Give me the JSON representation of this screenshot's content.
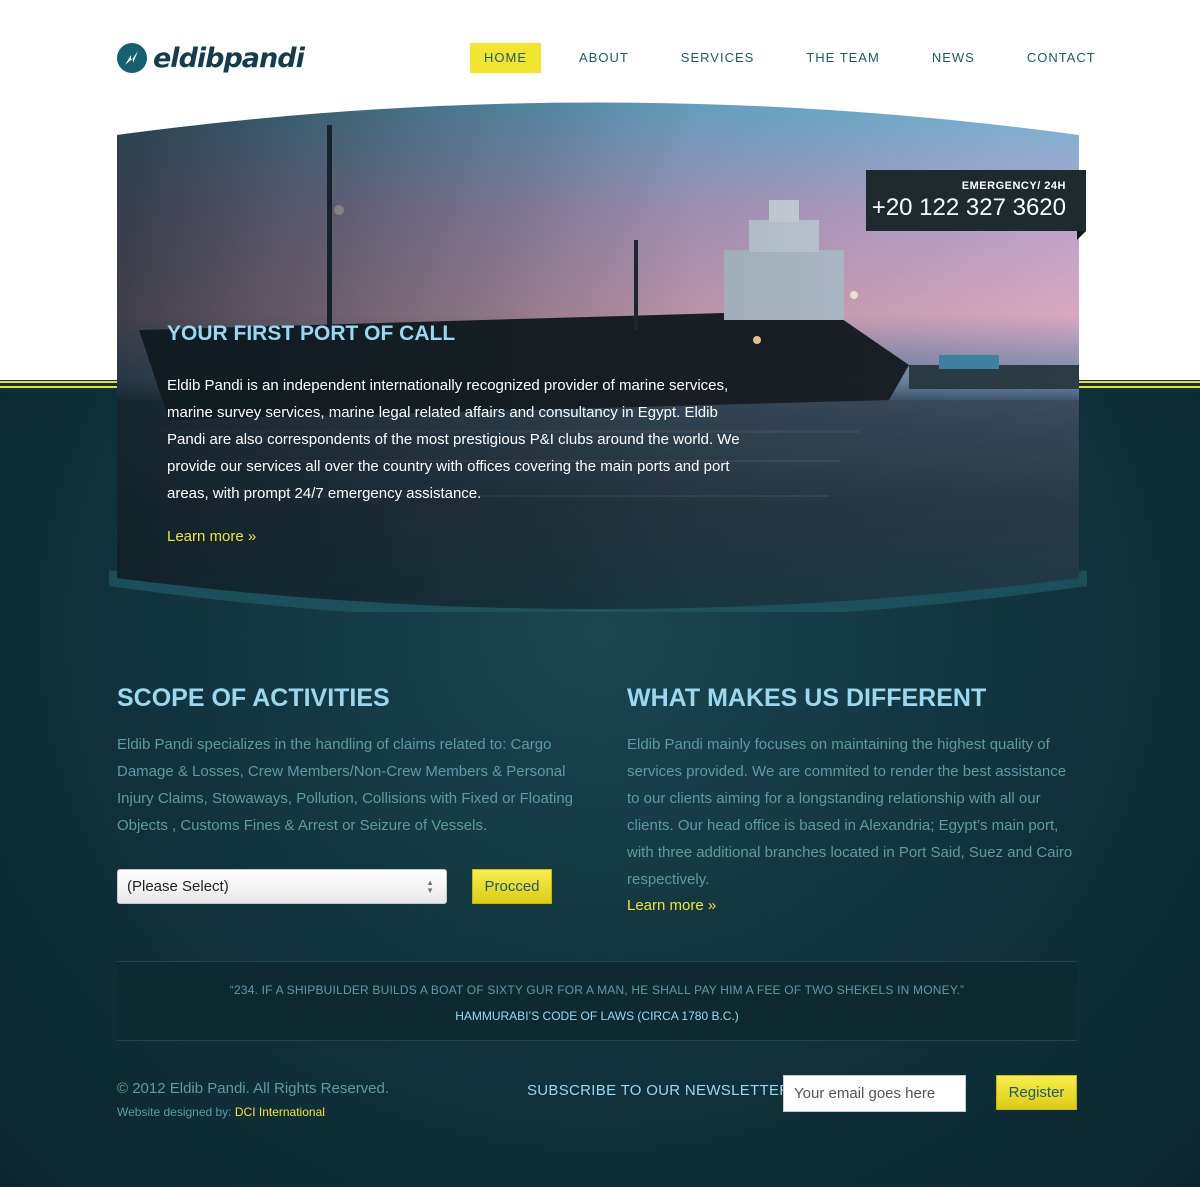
{
  "header": {
    "logo_text": "eldibpandi",
    "nav": [
      {
        "label": "HOME",
        "active": true
      },
      {
        "label": "ABOUT",
        "active": false
      },
      {
        "label": "SERVICES",
        "active": false
      },
      {
        "label": "THE TEAM",
        "active": false
      },
      {
        "label": "NEWS",
        "active": false
      },
      {
        "label": "CONTACT",
        "active": false
      }
    ]
  },
  "hero": {
    "title": "YOUR FIRST PORT OF CALL",
    "text": "Eldib Pandi is an independent internationally recognized provider of marine services, marine survey services, marine legal related affairs and consultancy in Egypt. Eldib Pandi are also correspondents of the most prestigious P&I clubs around the world. We provide our services all over the country with offices covering the main ports and port areas, with prompt 24/7 emergency assistance.",
    "link": "Learn more »",
    "emergency_label": "EMERGENCY/ 24H",
    "emergency_phone": "+20 122 327 3620"
  },
  "scope": {
    "title": "SCOPE OF ACTIVITIES",
    "text": "Eldib Pandi specializes in the handling of claims related to: Cargo Damage & Losses, Crew Members/Non-Crew Members & Personal Injury Claims, Stowaways, Pollution, Collisions with Fixed or Floating Objects , Customs Fines & Arrest or Seizure of Vessels.",
    "select_value": "(Please Select)",
    "button": "Procced"
  },
  "different": {
    "title": "WHAT MAKES US DIFFERENT",
    "text": "Eldib Pandi mainly focuses on maintaining the highest quality of services provided. We are commited to render the best assistance to our clients aiming for a longstanding relationship with all our clients. Our head office is based in Alexandria; Egypt’s main port, with three additional branches located in Port Said, Suez and Cairo respectively.",
    "link": "Learn more »"
  },
  "quote": {
    "text": "“234. IF A SHIPBUILDER BUILDS A BOAT OF SIXTY GUR FOR A MAN, HE SHALL PAY HIM A FEE OF TWO SHEKELS IN MONEY.”",
    "author": "HAMMURABI’S CODE OF LAWS (CIRCA 1780 B.C.)"
  },
  "footer": {
    "copyright": "© 2012 Eldib Pandi. All Rights Reserved.",
    "designed_label": "Website designed by: ",
    "designed_link": "DCI International",
    "newsletter_label": "SUBSCRIBE TO OUR NEWSLETTER",
    "email_placeholder": "Your email goes here",
    "register_button": "Register"
  },
  "colors": {
    "accent_yellow": "#f1e52e",
    "light_blue": "#9ad7f0",
    "muted_teal": "#5d9aa5",
    "dark_teal": "#0f3039"
  }
}
